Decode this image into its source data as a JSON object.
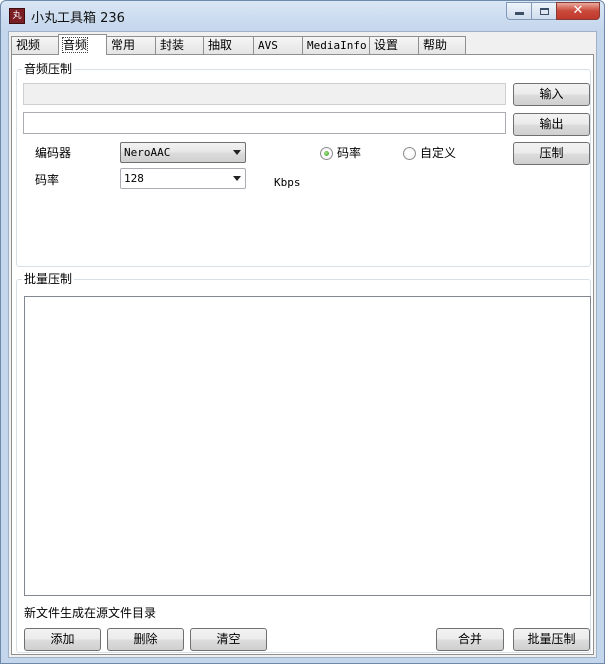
{
  "window": {
    "title": "小丸工具箱 236"
  },
  "tabs": [
    {
      "label": "视频",
      "active": false
    },
    {
      "label": "音频",
      "active": true
    },
    {
      "label": "常用",
      "active": false
    },
    {
      "label": "封装",
      "active": false
    },
    {
      "label": "抽取",
      "active": false
    },
    {
      "label": "AVS",
      "active": false
    },
    {
      "label": "MediaInfo",
      "active": false
    },
    {
      "label": "设置",
      "active": false
    },
    {
      "label": "帮助",
      "active": false
    }
  ],
  "audio": {
    "group_title": "音频压制",
    "input_value": "",
    "output_value": "",
    "input_button": "输入",
    "output_button": "输出",
    "compress_button": "压制",
    "encoder_label": "编码器",
    "encoder_value": "NeroAAC",
    "bitrate_label": "码率",
    "bitrate_value": "128",
    "bitrate_unit": "Kbps",
    "mode_bitrate_label": "码率",
    "mode_custom_label": "自定义",
    "mode_selected": "bitrate"
  },
  "batch": {
    "group_title": "批量压制",
    "items": [],
    "note": "新文件生成在源文件目录",
    "add_button": "添加",
    "delete_button": "删除",
    "clear_button": "清空",
    "merge_button": "合并",
    "batch_button": "批量压制"
  },
  "colors": {
    "title_bar": "#c4d6ec",
    "close_button": "#c9483a",
    "radio_selected": "#2f9a17"
  }
}
